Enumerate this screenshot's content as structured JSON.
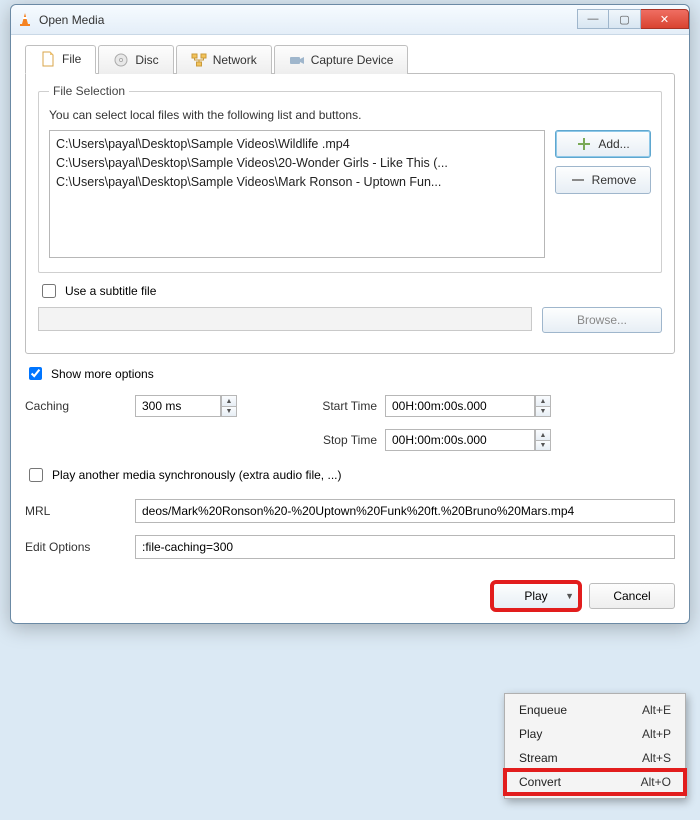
{
  "window": {
    "title": "Open Media"
  },
  "tabs": {
    "file": "File",
    "disc": "Disc",
    "network": "Network",
    "capture": "Capture Device"
  },
  "file_selection": {
    "legend": "File Selection",
    "description": "You can select local files with the following list and buttons.",
    "files": [
      "C:\\Users\\payal\\Desktop\\Sample Videos\\Wildlife .mp4",
      "C:\\Users\\payal\\Desktop\\Sample Videos\\20-Wonder Girls - Like This (...",
      "C:\\Users\\payal\\Desktop\\Sample Videos\\Mark Ronson - Uptown Fun..."
    ],
    "add_label": "Add...",
    "remove_label": "Remove",
    "use_subtitle_label": "Use a subtitle file",
    "browse_label": "Browse..."
  },
  "show_more_label": "Show more options",
  "options": {
    "caching_label": "Caching",
    "caching_value": "300 ms",
    "start_label": "Start Time",
    "start_value": "00H:00m:00s.000",
    "stop_label": "Stop Time",
    "stop_value": "00H:00m:00s.000",
    "play_another_label": "Play another media synchronously (extra audio file, ...)",
    "mrl_label": "MRL",
    "mrl_value": "deos/Mark%20Ronson%20-%20Uptown%20Funk%20ft.%20Bruno%20Mars.mp4",
    "edit_label": "Edit Options",
    "edit_value": ":file-caching=300"
  },
  "footer": {
    "play": "Play",
    "cancel": "Cancel"
  },
  "dropdown": {
    "items": [
      {
        "label": "Enqueue",
        "shortcut": "Alt+E"
      },
      {
        "label": "Play",
        "shortcut": "Alt+P"
      },
      {
        "label": "Stream",
        "shortcut": "Alt+S"
      },
      {
        "label": "Convert",
        "shortcut": "Alt+O"
      }
    ]
  }
}
